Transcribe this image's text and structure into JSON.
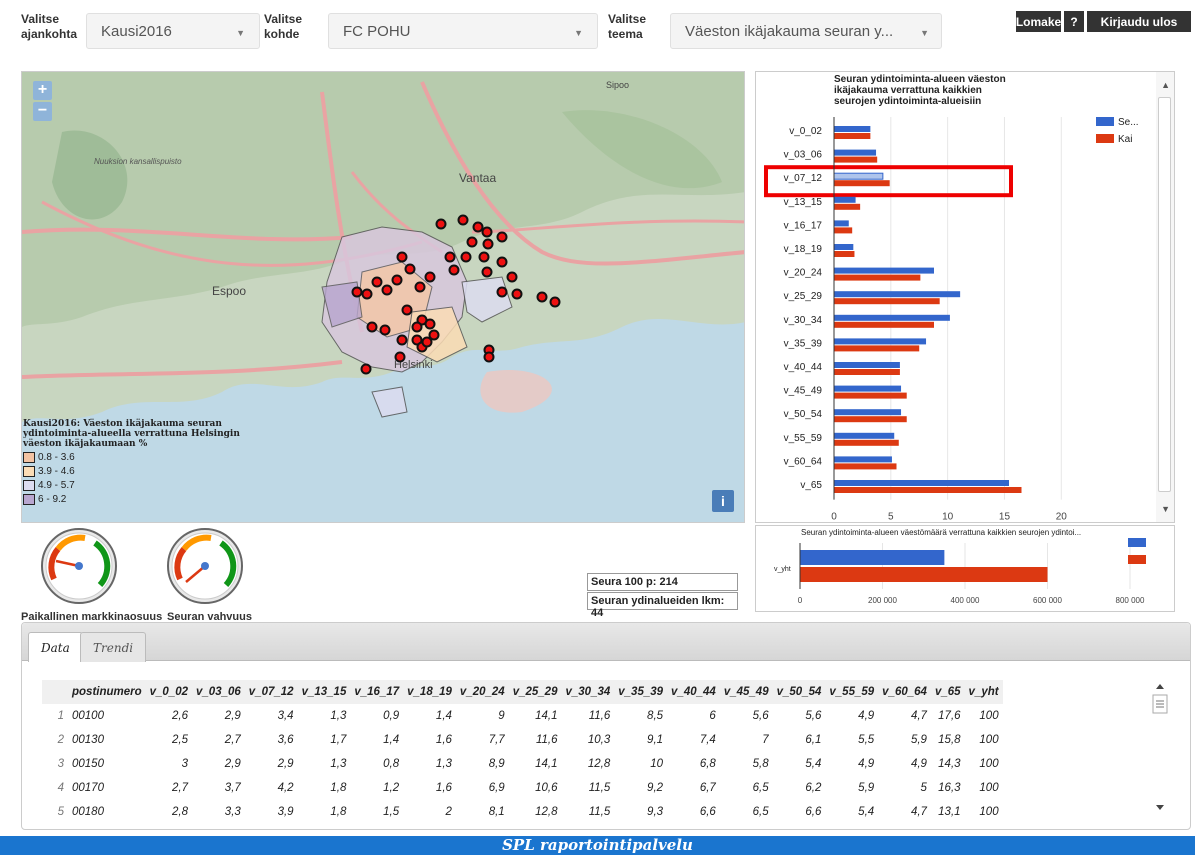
{
  "top": {
    "time_label": "Valitse\najankohta",
    "time_value": "Kausi2016",
    "target_label": "Valitse\nkohde",
    "target_value": "FC POHU",
    "theme_label": "Valitse\nteema",
    "theme_value": "Väeston ikäjakauma seuran y...",
    "btn_form": "Lomake",
    "btn_help": "?",
    "btn_logout": "Kirjaudu ulos"
  },
  "map": {
    "zoom_in": "+",
    "zoom_out": "−",
    "info": "i",
    "places": [
      "Espoo",
      "Vantaa",
      "Helsinki",
      "Sipoo",
      "Nuuksion\nkansallispuisto"
    ],
    "legend_title": "Kausi2016: Väeston ikäjakauma seuran ydintoiminta-alueella verrattuna Helsingin väeston ikäjakaumaan %",
    "legend": [
      {
        "label": "0.8 - 3.6",
        "color": "#f3c3a3"
      },
      {
        "label": "3.9 - 4.6",
        "color": "#fbdcb5"
      },
      {
        "label": "4.9 - 5.7",
        "color": "#dcdcf0"
      },
      {
        "label": "6 - 9.2",
        "color": "#b8a6cf"
      }
    ]
  },
  "chart_data": [
    {
      "type": "bar",
      "orientation": "horizontal",
      "title": "Seuran ydintoiminta-alueen väeston ikäjakauma verrattuna kaikkien seurojen ydintoiminta-alueisiin",
      "categories": [
        "v_0_02",
        "v_03_06",
        "v_07_12",
        "v_13_15",
        "v_16_17",
        "v_18_19",
        "v_20_24",
        "v_25_29",
        "v_30_34",
        "v_35_39",
        "v_40_44",
        "v_45_49",
        "v_50_54",
        "v_55_59",
        "v_60_64",
        "v_65"
      ],
      "series": [
        {
          "name": "Se...",
          "color": "#3366cc",
          "values": [
            3.2,
            3.7,
            4.3,
            1.9,
            1.3,
            1.7,
            8.8,
            11.1,
            10.2,
            8.1,
            5.8,
            5.9,
            5.9,
            5.3,
            5.1,
            15.4
          ]
        },
        {
          "name": "Kai",
          "color": "#dc3912",
          "values": [
            3.2,
            3.8,
            4.9,
            2.3,
            1.6,
            1.8,
            7.6,
            9.3,
            8.8,
            7.5,
            5.8,
            6.4,
            6.4,
            5.7,
            5.5,
            16.5
          ]
        }
      ],
      "xticks": [
        "0",
        "5",
        "10",
        "15",
        "20"
      ],
      "xlim": [
        0,
        22
      ],
      "highlight": "v_07_12"
    },
    {
      "type": "bar",
      "orientation": "horizontal",
      "title": "Seuran ydintoiminta-alueen väestömäärä verrattuna kaikkien seurojen ydintoi...",
      "categories": [
        "v_yht"
      ],
      "series": [
        {
          "name": "",
          "color": "#3366cc",
          "values": [
            350000
          ]
        },
        {
          "name": "",
          "color": "#dc3912",
          "values": [
            600000
          ]
        }
      ],
      "xticks": [
        "0",
        "200 000",
        "400 000",
        "600 000",
        "800 000"
      ],
      "xlim": [
        0,
        800000
      ]
    }
  ],
  "gauges": {
    "label1": "Paikallinen markkinaosuus",
    "label2": "Seuran vahvuus"
  },
  "stats": {
    "s1": "Seura 100 p: 214",
    "s2": "Seuran ydinalueiden lkm: 44"
  },
  "tabs": {
    "data": "Data",
    "trend": "Trendi"
  },
  "table": {
    "columns": [
      "postinumero",
      "v_0_02",
      "v_03_06",
      "v_07_12",
      "v_13_15",
      "v_16_17",
      "v_18_19",
      "v_20_24",
      "v_25_29",
      "v_30_34",
      "v_35_39",
      "v_40_44",
      "v_45_49",
      "v_50_54",
      "v_55_59",
      "v_60_64",
      "v_65",
      "v_yht"
    ],
    "rows": [
      [
        "1",
        "00100",
        "2,6",
        "2,9",
        "3,4",
        "1,3",
        "0,9",
        "1,4",
        "9",
        "14,1",
        "11,6",
        "8,5",
        "6",
        "5,6",
        "5,6",
        "4,9",
        "4,7",
        "17,6",
        "100"
      ],
      [
        "2",
        "00130",
        "2,5",
        "2,7",
        "3,6",
        "1,7",
        "1,4",
        "1,6",
        "7,7",
        "11,6",
        "10,3",
        "9,1",
        "7,4",
        "7",
        "6,1",
        "5,5",
        "5,9",
        "15,8",
        "100"
      ],
      [
        "3",
        "00150",
        "3",
        "2,9",
        "2,9",
        "1,3",
        "0,8",
        "1,3",
        "8,9",
        "14,1",
        "12,8",
        "10",
        "6,8",
        "5,8",
        "5,4",
        "4,9",
        "4,9",
        "14,3",
        "100"
      ],
      [
        "4",
        "00170",
        "2,7",
        "3,7",
        "4,2",
        "1,8",
        "1,2",
        "1,6",
        "6,9",
        "10,6",
        "11,5",
        "9,2",
        "6,7",
        "6,5",
        "6,2",
        "5,9",
        "5",
        "16,3",
        "100"
      ],
      [
        "5",
        "00180",
        "2,8",
        "3,3",
        "3,9",
        "1,8",
        "1,5",
        "2",
        "8,1",
        "12,8",
        "11,5",
        "9,3",
        "6,6",
        "6,5",
        "6,6",
        "5,4",
        "4,7",
        "13,1",
        "100"
      ]
    ]
  },
  "footer": "SPL raportointipalvelu"
}
